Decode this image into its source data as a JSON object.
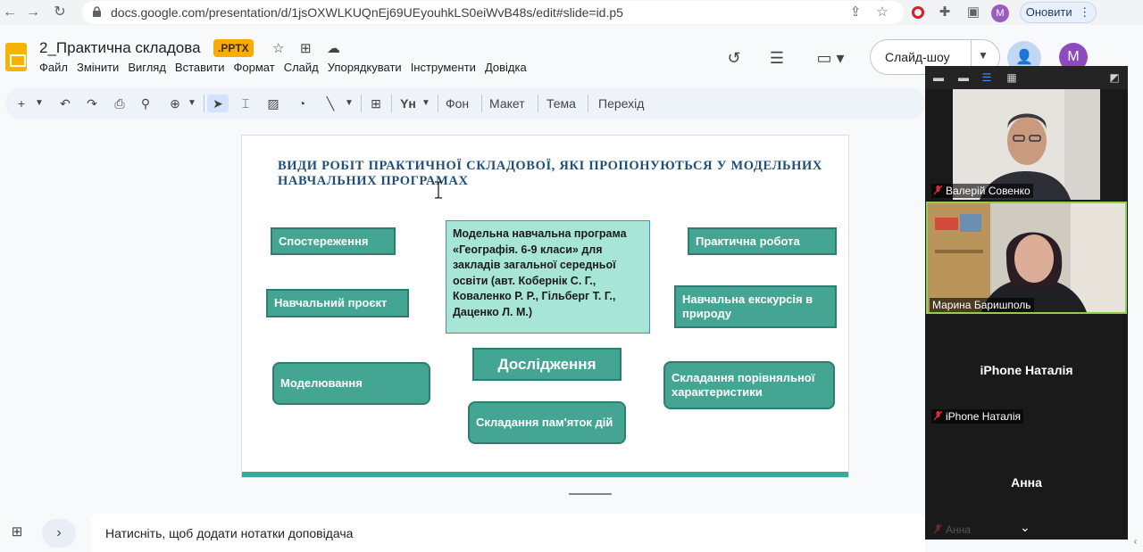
{
  "browser": {
    "url": "docs.google.com/presentation/d/1jsOXWLKUQnEj69UEyouhkLS0eiWvB48s/edit#slide=id.p5",
    "update_label": "Оновити",
    "profile_initial": "M"
  },
  "doc": {
    "title": "2_Практична складова",
    "badge": ".PPTX",
    "menu": [
      "Файл",
      "Змінити",
      "Вигляд",
      "Вставити",
      "Формат",
      "Слайд",
      "Упорядкувати",
      "Інструменти",
      "Довідка"
    ],
    "slideshow_label": "Слайд-шоу",
    "avatar_initial": "M"
  },
  "toolbar": {
    "background": "Фон",
    "layout": "Макет",
    "theme": "Тема",
    "transition": "Перехід"
  },
  "slide": {
    "title": "ВИДИ РОБІТ ПРАКТИЧНОЇ СКЛАДОВОЇ, ЯКІ ПРОПОНУЮТЬСЯ У МОДЕЛЬНИХ НАВЧАЛЬНИХ ПРОГРАМАХ",
    "center_text": "Модельна навчальна програма «Географія. 6-9 класи» для закладів загальної середньої освіти (авт. Кобернік С. Г., Коваленко Р. Р., Гільберг Т. Г., Даценко Л. М.)",
    "boxes": {
      "observation": "Спостереження",
      "practical": "Практична робота",
      "project": "Навчальний проєкт",
      "excursion": "Навчальна екскурсія в природу",
      "modeling": "Моделювання",
      "research": "Дослідження",
      "comparison": "Складання порівняльної характеристики",
      "memo": "Складання пам'яток дій"
    },
    "accent_color": "#45a593"
  },
  "notes": {
    "placeholder": "Натисніть, щоб додати нотатки доповідача"
  },
  "meeting": {
    "participants": [
      {
        "name": "Валерій Совенко",
        "muted": true
      },
      {
        "name": "Марина Баришполь",
        "muted": false
      },
      {
        "name": "iPhone Наталія",
        "muted": true
      },
      {
        "name": "Анна",
        "muted": true
      }
    ]
  }
}
